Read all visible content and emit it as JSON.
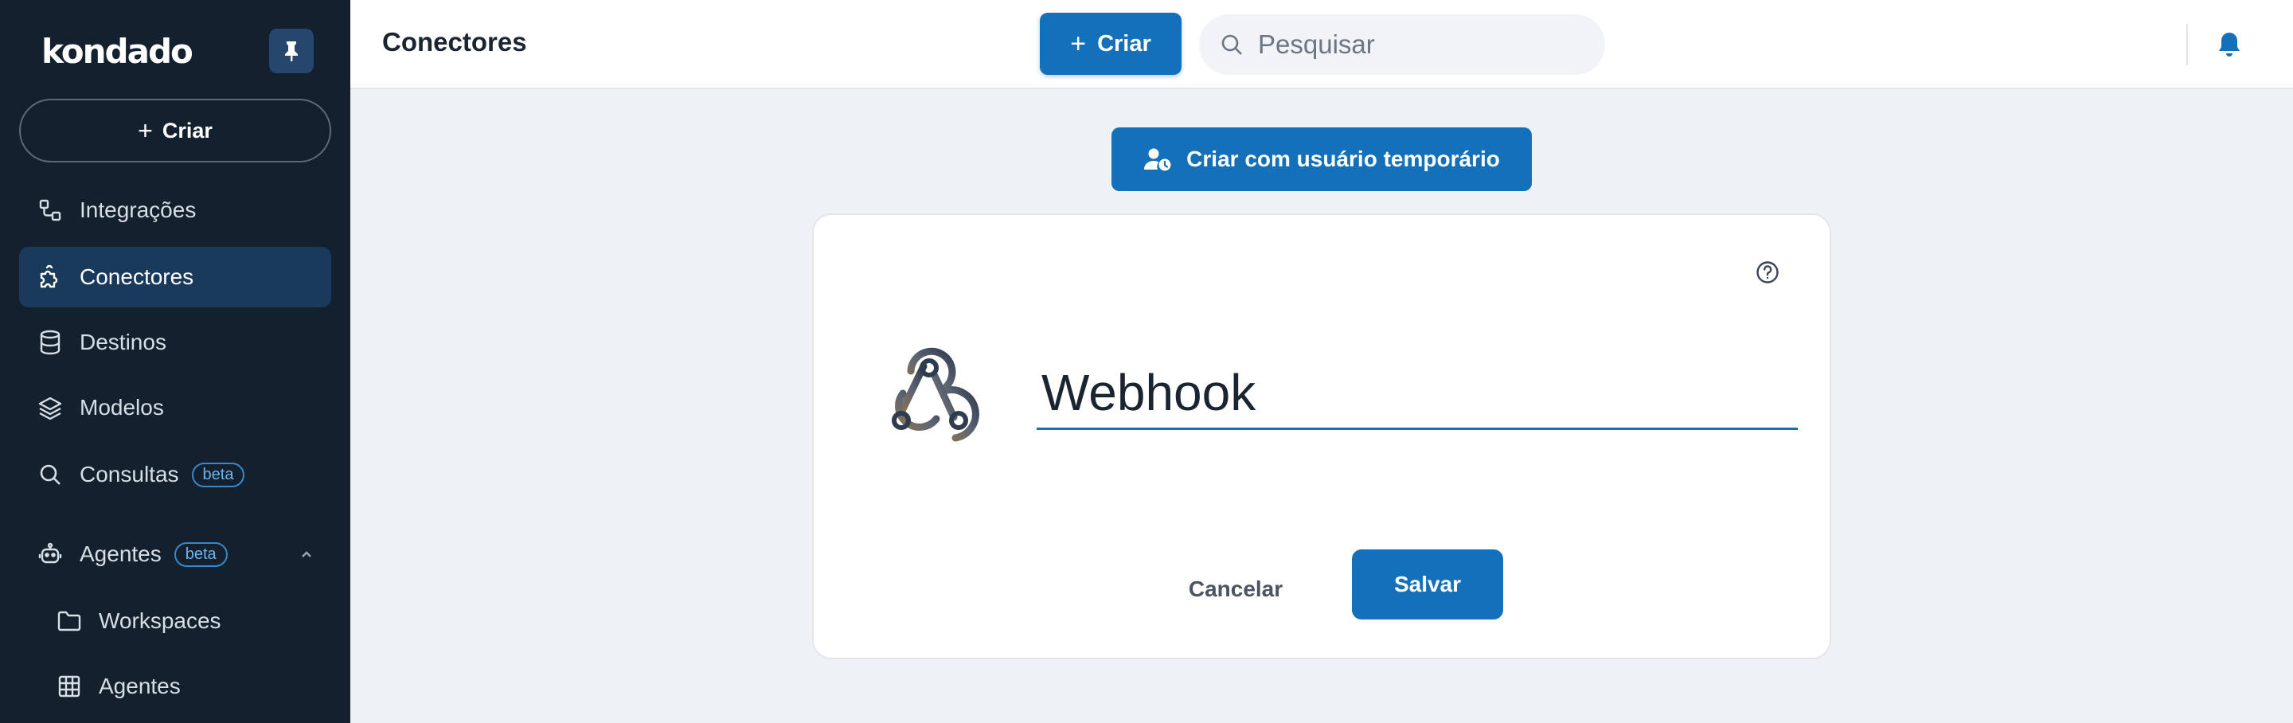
{
  "brand": {
    "logo_text": "kondado",
    "accent": "#1470b8",
    "sidebar_bg": "#13202e"
  },
  "sidebar": {
    "pin_icon": "pin-icon",
    "create_label": "Criar",
    "items": [
      {
        "label": "Integrações",
        "icon": "integrations-icon",
        "active": false
      },
      {
        "label": "Conectores",
        "icon": "puzzle-icon",
        "active": true
      },
      {
        "label": "Destinos",
        "icon": "database-icon",
        "active": false
      },
      {
        "label": "Modelos",
        "icon": "layers-icon",
        "active": false
      },
      {
        "label": "Consultas",
        "icon": "search-icon",
        "active": false,
        "badge": "beta"
      },
      {
        "label": "Agentes",
        "icon": "robot-icon",
        "active": false,
        "badge": "beta",
        "expanded": true
      },
      {
        "label": "Workspaces",
        "icon": "folder-icon",
        "active": false
      },
      {
        "label": "Agentes",
        "icon": "table-grid-icon",
        "active": false
      }
    ]
  },
  "header": {
    "title": "Conectores",
    "create_label": "Criar",
    "search_placeholder": "Pesquisar",
    "notification_icon": "bell-icon"
  },
  "main": {
    "temp_user_button": "Criar com usuário temporário",
    "connector": {
      "name": "Webhook",
      "logo_icon": "webhook-icon",
      "help_icon": "help-circle-icon"
    },
    "cancel_label": "Cancelar",
    "save_label": "Salvar"
  }
}
